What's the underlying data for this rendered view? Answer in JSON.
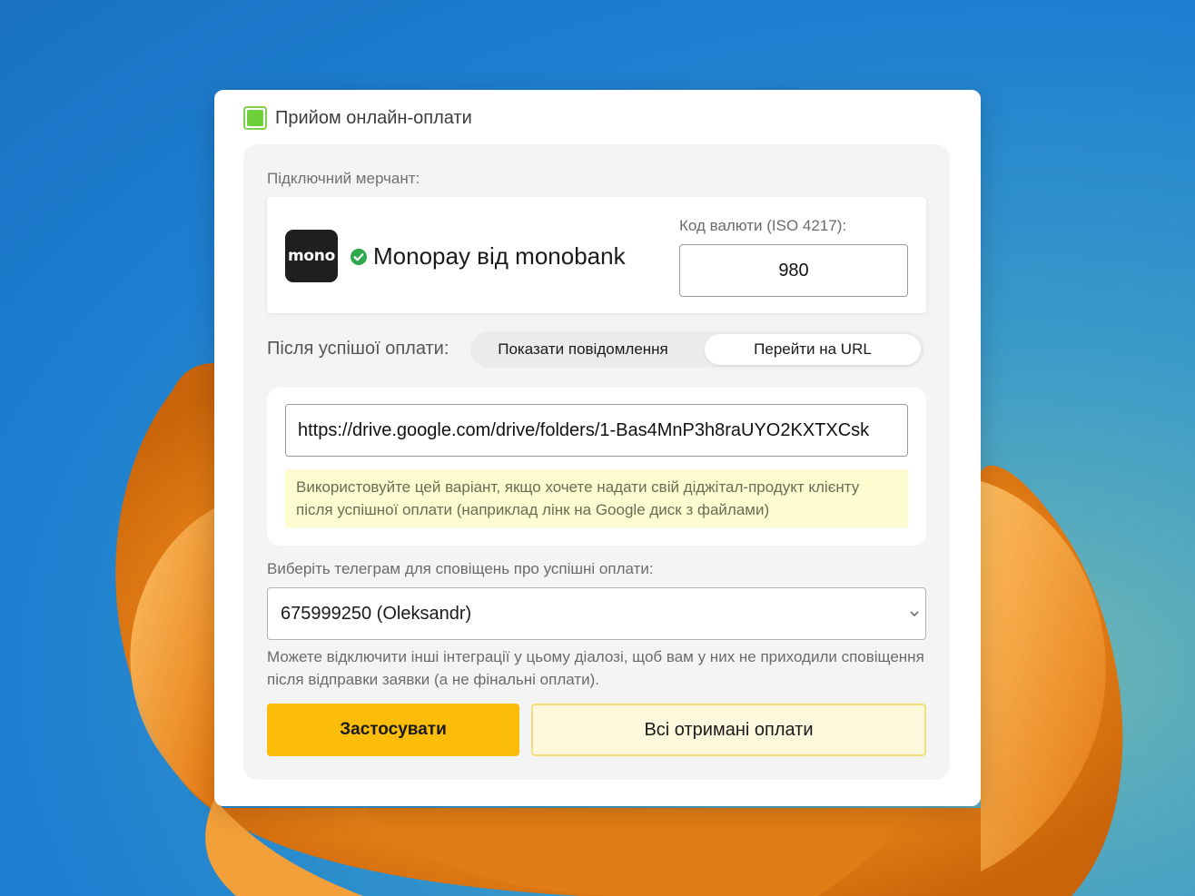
{
  "colors": {
    "accent_yellow": "#fbbd0a",
    "checkbox_green": "#6fd03c",
    "check_icon_green": "#2ea84a",
    "hint_background": "#fdfbd0"
  },
  "header": {
    "checkbox_checked": true,
    "title": "Прийом онлайн-оплати"
  },
  "merchant": {
    "section_label": "Підключний мерчант:",
    "logo_text": "mono",
    "status_icon": "check-circle-icon",
    "name": "Monopay від monobank",
    "currency_label": "Код валюти (ISO 4217):",
    "currency_value": "980"
  },
  "after_payment": {
    "label": "Після успішої оплати:",
    "options": [
      "Показати повідомлення",
      "Перейти на URL"
    ],
    "selected": "Перейти на URL"
  },
  "url": {
    "value": "https://drive.google.com/drive/folders/1-Bas4MnP3h8raUYO2KXTXCsk",
    "hint": "Використовуйте цей варіант, якщо хочете надати свій діджітал-продукт клієнту після успішної оплати (наприклад лінк на Google диск з файлами)"
  },
  "telegram": {
    "label": "Виберіть телеграм для сповіщень про успішні оплати:",
    "selected": "675999250 (Oleksandr)",
    "icon": "chevron-down-icon"
  },
  "note": "Можете відключити інші інтеграції у цьому діалозі, щоб вам у них не приходили сповіщення після відправки заявки (а не фінальні оплати).",
  "buttons": {
    "apply": "Застосувати",
    "all_payments": "Всі отримані оплати"
  }
}
